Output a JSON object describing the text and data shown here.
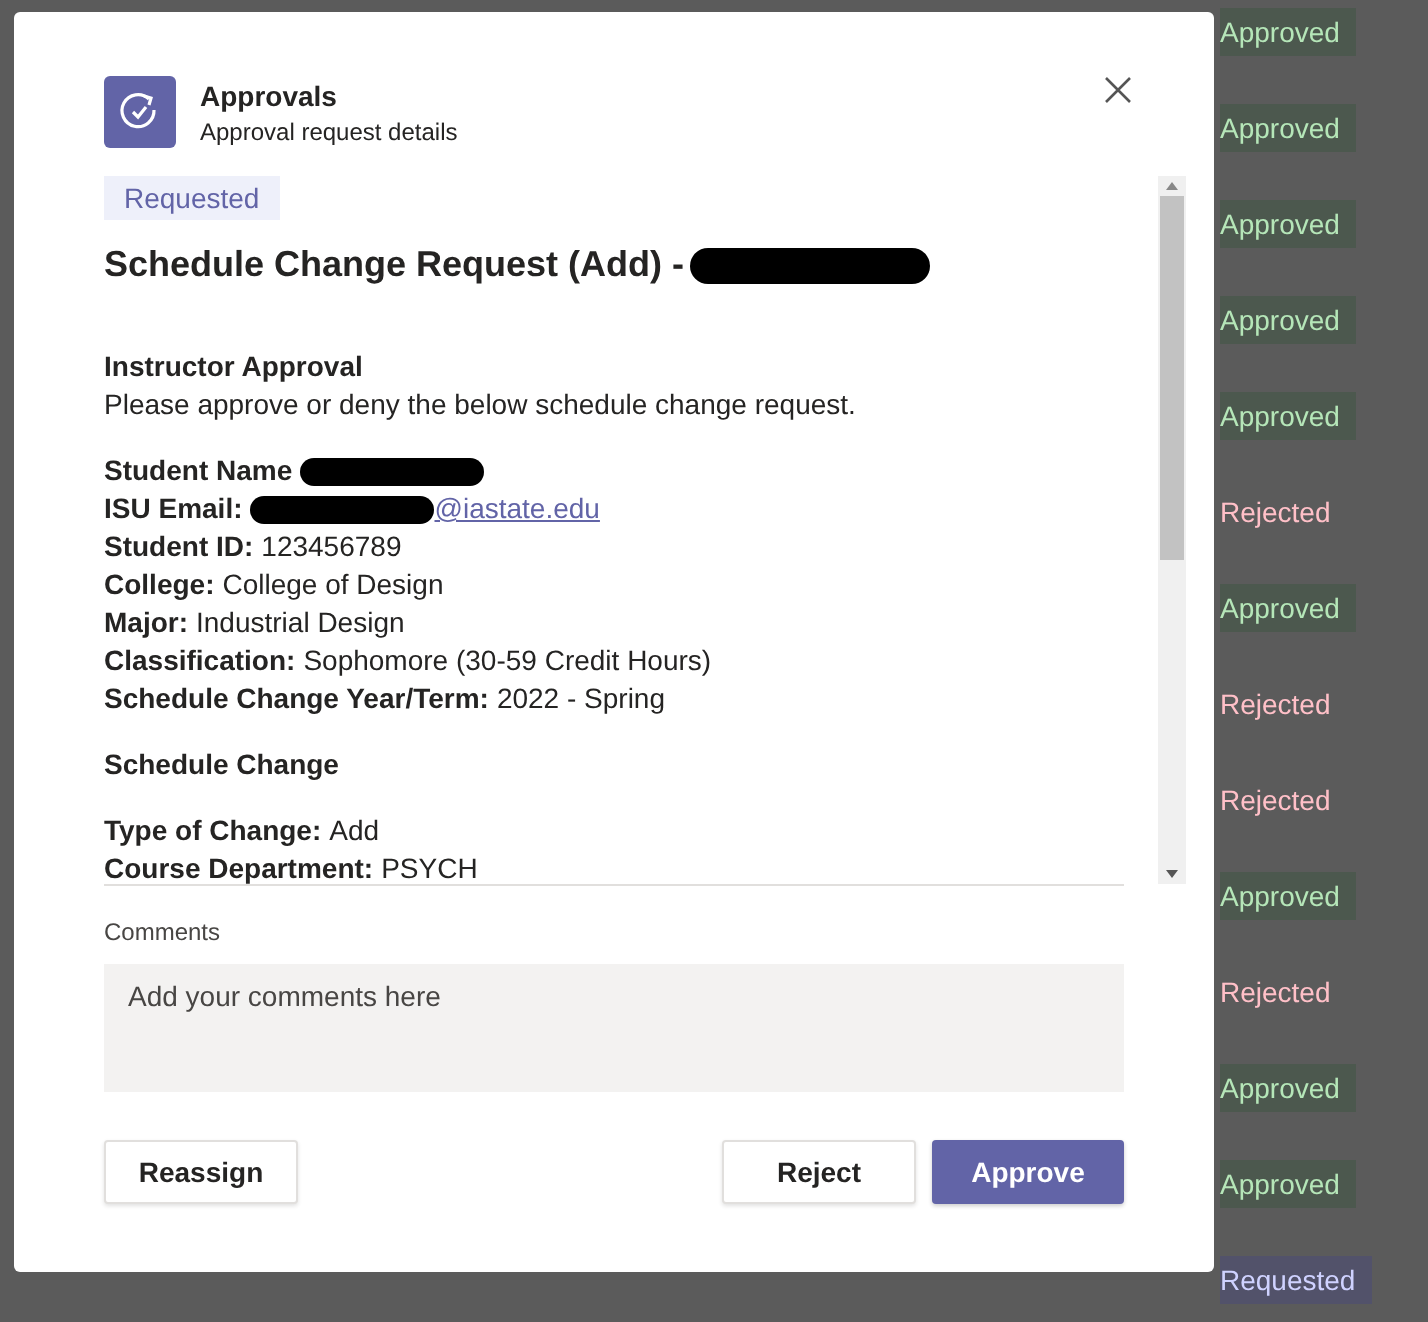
{
  "background_list": [
    {
      "status": "Approved",
      "kind": "approved"
    },
    {
      "status": "Approved",
      "kind": "approved"
    },
    {
      "status": "Approved",
      "kind": "approved"
    },
    {
      "status": "Approved",
      "kind": "approved"
    },
    {
      "status": "Approved",
      "kind": "approved"
    },
    {
      "status": "Rejected",
      "kind": "rejected"
    },
    {
      "status": "Approved",
      "kind": "approved"
    },
    {
      "status": "Rejected",
      "kind": "rejected"
    },
    {
      "status": "Rejected",
      "kind": "rejected"
    },
    {
      "status": "Approved",
      "kind": "approved"
    },
    {
      "status": "Rejected",
      "kind": "rejected"
    },
    {
      "status": "Approved",
      "kind": "approved"
    },
    {
      "status": "Approved",
      "kind": "approved"
    },
    {
      "status": "Requested",
      "kind": "requested"
    }
  ],
  "dialog": {
    "app_name": "Approvals",
    "subtitle": "Approval request details",
    "status_tag": "Requested",
    "title": "Schedule Change Request (Add) -",
    "title_redacted": true,
    "section_heading": "Instructor Approval",
    "instructions": "Please approve or deny the below schedule change request.",
    "fields": [
      {
        "label": "Student Name",
        "redacted": true
      },
      {
        "label": "ISU Email:",
        "link": "@iastate.edu",
        "redacted": true
      },
      {
        "label": "Student ID:",
        "value": "123456789"
      },
      {
        "label": "College:",
        "value": "College of Design"
      },
      {
        "label": "Major:",
        "value": "Industrial Design"
      },
      {
        "label": "Classification:",
        "value": "Sophomore (30-59 Credit Hours)"
      },
      {
        "label": "Schedule Change Year/Term:",
        "value": "2022 -  Spring"
      }
    ],
    "change_heading": "Schedule Change",
    "change_fields": [
      {
        "label": "Type of Change:",
        "value": "Add"
      },
      {
        "label": "Course Department:",
        "value": "PSYCH"
      }
    ],
    "comments_label": "Comments",
    "comments_placeholder": "Add your comments here",
    "buttons": [
      {
        "label": "Reassign",
        "kind": "secondary"
      },
      {
        "label": "Reject",
        "kind": "secondary"
      },
      {
        "label": "Approve",
        "kind": "primary"
      }
    ]
  }
}
